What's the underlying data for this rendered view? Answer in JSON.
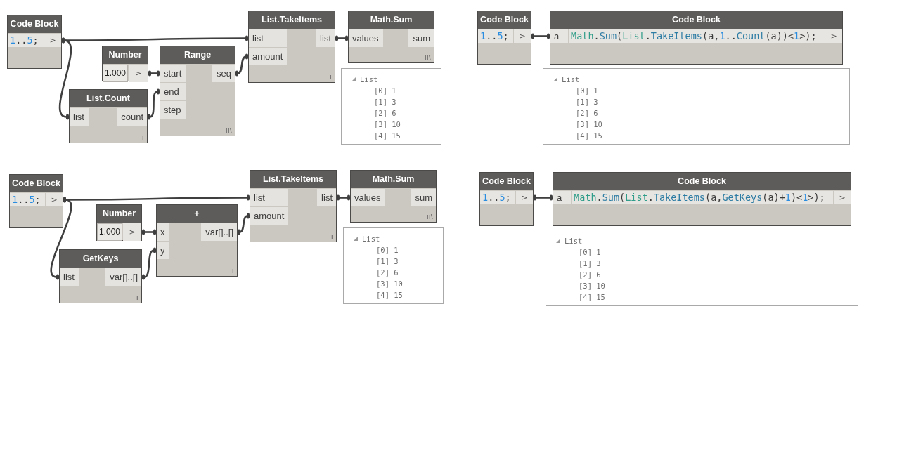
{
  "graphs": [
    {
      "nodes": [
        {
          "kind": "code_block",
          "title": "Code Block",
          "code": [
            {
              "text": "1",
              "kind": "number"
            },
            {
              "text": "..",
              "kind": "plain"
            },
            {
              "text": "5",
              "kind": "number"
            },
            {
              "text": ";",
              "kind": "plain"
            }
          ],
          "outputs": [
            ">"
          ]
        },
        {
          "kind": "number",
          "title": "Number",
          "value": "1.000",
          "outputs": [
            ">"
          ]
        },
        {
          "kind": "function",
          "title": "Range",
          "inputs": [
            "start",
            "end",
            "step"
          ],
          "outputs": [
            "seq"
          ],
          "lacing": "II\\"
        },
        {
          "kind": "function",
          "title": "List.Count",
          "inputs": [
            "list"
          ],
          "outputs": [
            "count"
          ],
          "lacing": "I"
        },
        {
          "kind": "function",
          "title": "List.TakeItems",
          "inputs": [
            "list",
            "amount"
          ],
          "outputs": [
            "list"
          ],
          "lacing": "I"
        },
        {
          "kind": "function",
          "title": "Math.Sum",
          "inputs": [
            "values"
          ],
          "outputs": [
            "sum"
          ],
          "lacing": "II\\"
        }
      ],
      "preview": {
        "label": "List",
        "expanded": true,
        "items": [
          "[0] 1",
          "[1] 3",
          "[2] 6",
          "[3] 10",
          "[4] 15"
        ]
      }
    },
    {
      "nodes": [
        {
          "kind": "code_block",
          "title": "Code Block",
          "code": [
            {
              "text": "1",
              "kind": "number"
            },
            {
              "text": "..",
              "kind": "plain"
            },
            {
              "text": "5",
              "kind": "number"
            },
            {
              "text": ";",
              "kind": "plain"
            }
          ],
          "outputs": [
            ">"
          ]
        },
        {
          "kind": "code_block",
          "title": "Code Block",
          "inputs": [
            "a"
          ],
          "code": [
            {
              "text": "Math",
              "kind": "class"
            },
            {
              "text": ".",
              "kind": "plain"
            },
            {
              "text": "Sum",
              "kind": "method"
            },
            {
              "text": "(",
              "kind": "plain"
            },
            {
              "text": "List",
              "kind": "class"
            },
            {
              "text": ".",
              "kind": "plain"
            },
            {
              "text": "TakeItems",
              "kind": "method"
            },
            {
              "text": "(a,",
              "kind": "plain"
            },
            {
              "text": "1",
              "kind": "number"
            },
            {
              "text": "..",
              "kind": "plain"
            },
            {
              "text": "Count",
              "kind": "method"
            },
            {
              "text": "(a))<",
              "kind": "plain"
            },
            {
              "text": "1",
              "kind": "number"
            },
            {
              "text": ">);",
              "kind": "plain"
            }
          ],
          "outputs": [
            ">"
          ]
        }
      ],
      "preview": {
        "label": "List",
        "expanded": true,
        "items": [
          "[0] 1",
          "[1] 3",
          "[2] 6",
          "[3] 10",
          "[4] 15"
        ]
      }
    },
    {
      "nodes": [
        {
          "kind": "code_block",
          "title": "Code Block",
          "code": [
            {
              "text": "1",
              "kind": "number"
            },
            {
              "text": "..",
              "kind": "plain"
            },
            {
              "text": "5",
              "kind": "number"
            },
            {
              "text": ";",
              "kind": "plain"
            }
          ],
          "outputs": [
            ">"
          ]
        },
        {
          "kind": "number",
          "title": "Number",
          "value": "1.000",
          "outputs": [
            ">"
          ]
        },
        {
          "kind": "function",
          "title": "+",
          "inputs": [
            "x",
            "y"
          ],
          "outputs": [
            "var[]..[]"
          ],
          "lacing": "I"
        },
        {
          "kind": "function",
          "title": "GetKeys",
          "inputs": [
            "list"
          ],
          "outputs": [
            "var[]..[]"
          ],
          "lacing": "I"
        },
        {
          "kind": "function",
          "title": "List.TakeItems",
          "inputs": [
            "list",
            "amount"
          ],
          "outputs": [
            "list"
          ],
          "lacing": "I"
        },
        {
          "kind": "function",
          "title": "Math.Sum",
          "inputs": [
            "values"
          ],
          "outputs": [
            "sum"
          ],
          "lacing": "II\\"
        }
      ],
      "preview": {
        "label": "List",
        "expanded": true,
        "items": [
          "[0] 1",
          "[1] 3",
          "[2] 6",
          "[3] 10",
          "[4] 15"
        ]
      }
    },
    {
      "nodes": [
        {
          "kind": "code_block",
          "title": "Code Block",
          "code": [
            {
              "text": "1",
              "kind": "number"
            },
            {
              "text": "..",
              "kind": "plain"
            },
            {
              "text": "5",
              "kind": "number"
            },
            {
              "text": ";",
              "kind": "plain"
            }
          ],
          "outputs": [
            ">"
          ]
        },
        {
          "kind": "code_block",
          "title": "Code Block",
          "inputs": [
            "a"
          ],
          "code": [
            {
              "text": "Math",
              "kind": "class"
            },
            {
              "text": ".",
              "kind": "plain"
            },
            {
              "text": "Sum",
              "kind": "method"
            },
            {
              "text": "(",
              "kind": "plain"
            },
            {
              "text": "List",
              "kind": "class"
            },
            {
              "text": ".",
              "kind": "plain"
            },
            {
              "text": "TakeItems",
              "kind": "method"
            },
            {
              "text": "(a,",
              "kind": "plain"
            },
            {
              "text": "GetKeys",
              "kind": "method"
            },
            {
              "text": "(a)+",
              "kind": "plain"
            },
            {
              "text": "1",
              "kind": "number"
            },
            {
              "text": ")<",
              "kind": "plain"
            },
            {
              "text": "1",
              "kind": "number"
            },
            {
              "text": ">);",
              "kind": "plain"
            }
          ],
          "outputs": [
            ">"
          ]
        }
      ],
      "preview": {
        "label": "List",
        "expanded": true,
        "items": [
          "[0] 1",
          "[1] 3",
          "[2] 6",
          "[3] 10",
          "[4] 15"
        ]
      }
    }
  ]
}
